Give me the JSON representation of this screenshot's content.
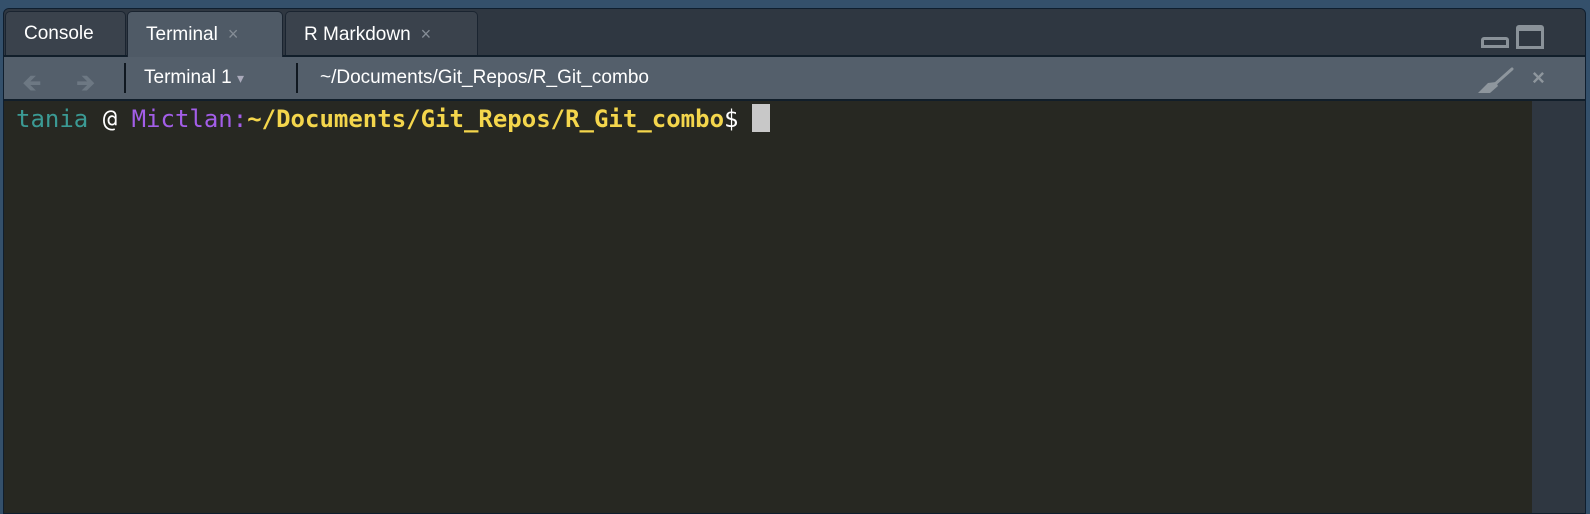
{
  "tabs": [
    {
      "label": "Console",
      "closable": false,
      "active": false
    },
    {
      "label": "Terminal",
      "closable": true,
      "active": true
    },
    {
      "label": "R Markdown",
      "closable": true,
      "active": false
    }
  ],
  "tab_close_glyph": "×",
  "toolbar": {
    "back_icon": "arrow-left-icon",
    "forward_icon": "arrow-right-icon",
    "terminal_select": "Terminal 1",
    "dropdown_glyph": "▾",
    "path": "~/Documents/Git_Repos/R_Git_combo",
    "clear_icon": "broom-icon",
    "close_glyph": "×"
  },
  "terminal": {
    "user": "tania",
    "at": " @ ",
    "host": "Mictlan:",
    "cwd": "~/Documents/Git_Repos/R_Git_combo",
    "prompt": "$"
  },
  "colors": {
    "user": "#3b9a94",
    "host": "#a35ee8",
    "cwd": "#f4d64c",
    "background": "#272822"
  }
}
